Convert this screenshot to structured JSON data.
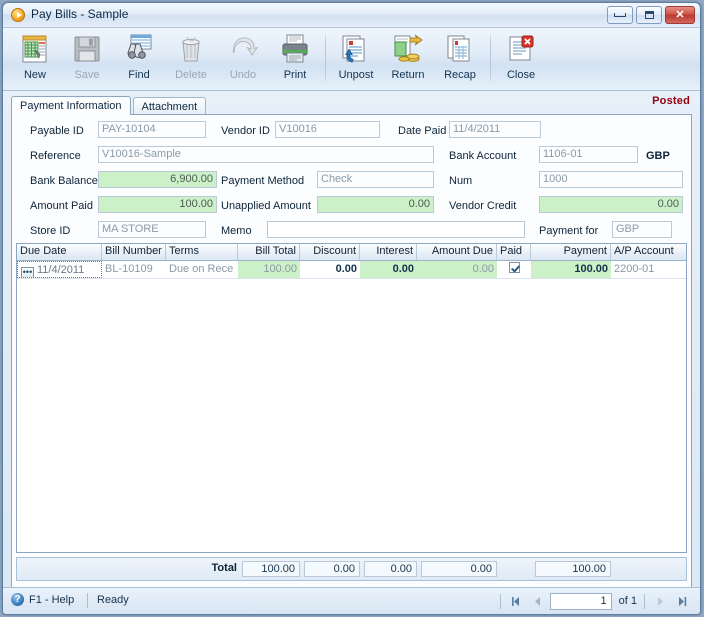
{
  "window": {
    "title": "Pay Bills - Sample",
    "icon": "play-circle-icon",
    "minimize_label": "Minimize",
    "maximize_label": "Maximize",
    "close_label": "Close"
  },
  "toolbar": {
    "buttons": [
      {
        "label": "New",
        "icon": "new-document-icon",
        "enabled": true
      },
      {
        "label": "Save",
        "icon": "floppy-disk-icon",
        "enabled": false
      },
      {
        "label": "Find",
        "icon": "binoculars-icon",
        "enabled": true
      },
      {
        "label": "Delete",
        "icon": "trash-can-icon",
        "enabled": false
      },
      {
        "label": "Undo",
        "icon": "undo-arrow-icon",
        "enabled": false
      },
      {
        "label": "Print",
        "icon": "printer-icon",
        "enabled": true
      },
      {
        "label": "Unpost",
        "icon": "unpost-icon",
        "enabled": true
      },
      {
        "label": "Return",
        "icon": "return-money-icon",
        "enabled": true
      },
      {
        "label": "Recap",
        "icon": "recap-icon",
        "enabled": true
      },
      {
        "label": "Close",
        "icon": "close-document-icon",
        "enabled": true
      }
    ]
  },
  "tabs": [
    {
      "label": "Payment Information",
      "active": true
    },
    {
      "label": "Attachment",
      "active": false
    }
  ],
  "status_flag": "Posted",
  "form": {
    "payable_id": {
      "label": "Payable ID",
      "value": "PAY-10104"
    },
    "vendor_id": {
      "label": "Vendor ID",
      "value": "V10016"
    },
    "date_paid": {
      "label": "Date Paid",
      "value": "11/4/2011"
    },
    "reference": {
      "label": "Reference",
      "value": "V10016-Sample"
    },
    "bank_account": {
      "label": "Bank Account",
      "value": "1106-01",
      "currency": "GBP"
    },
    "bank_balance": {
      "label": "Bank Balance",
      "value": "6,900.00"
    },
    "payment_method": {
      "label": "Payment Method",
      "value": "Check"
    },
    "num": {
      "label": "Num",
      "value": "1000"
    },
    "amount_paid": {
      "label": "Amount Paid",
      "value": "100.00"
    },
    "unapplied_amount": {
      "label": "Unapplied Amount",
      "value": "0.00"
    },
    "vendor_credit": {
      "label": "Vendor Credit",
      "value": "0.00"
    },
    "store_id": {
      "label": "Store ID",
      "value": "MA STORE"
    },
    "memo": {
      "label": "Memo",
      "value": ""
    },
    "payment_for": {
      "label": "Payment for",
      "value": "GBP"
    }
  },
  "grid": {
    "columns": [
      "Due Date",
      "Bill Number",
      "Terms",
      "Bill Total",
      "Discount",
      "Interest",
      "Amount Due",
      "Paid",
      "Payment",
      "A/P Account"
    ],
    "rows": [
      {
        "due_date": "11/4/2011",
        "bill_number": "BL-10109",
        "terms": "Due on Rece",
        "bill_total": "100.00",
        "discount": "0.00",
        "interest": "0.00",
        "amount_due": "0.00",
        "paid": true,
        "payment": "100.00",
        "ap_account": "2200-01"
      }
    ]
  },
  "totals": {
    "label": "Total",
    "bill_total": "100.00",
    "discount": "0.00",
    "interest": "0.00",
    "amount_due": "0.00",
    "payment": "100.00"
  },
  "statusbar": {
    "help_icon": "question-mark-icon",
    "help": "F1 - Help",
    "ready": "Ready",
    "page_value": "1",
    "of_text": "of 1",
    "first_label": "First record",
    "prev_label": "Previous record",
    "next_label": "Next record",
    "last_label": "Last record"
  },
  "colors": {
    "accent": "#2d72b0",
    "posted": "#93000f",
    "calculated_field": "#ccf0c8",
    "frame": "#8aa6c0"
  }
}
